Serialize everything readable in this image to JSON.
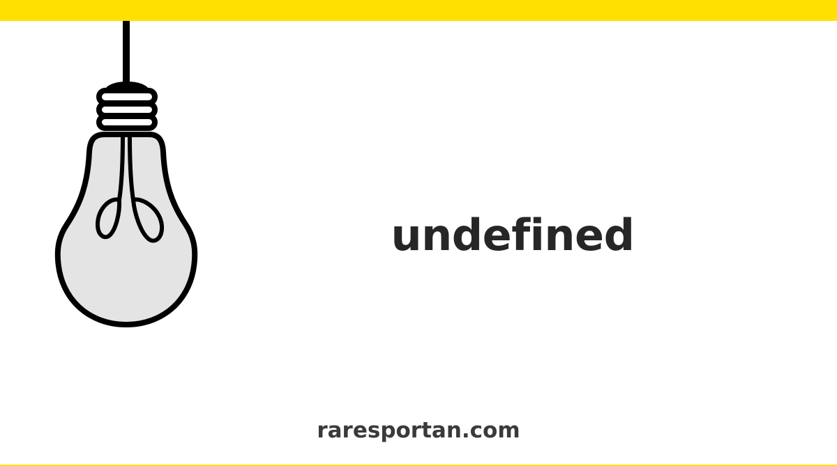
{
  "heading": "undefined",
  "site": "raresportan.com",
  "colors": {
    "accent": "#FFE000",
    "text": "#262626",
    "bulb_fill": "#E4E4E4",
    "bulb_stroke": "#000000"
  },
  "icons": {
    "bulb": "light-bulb-icon"
  }
}
